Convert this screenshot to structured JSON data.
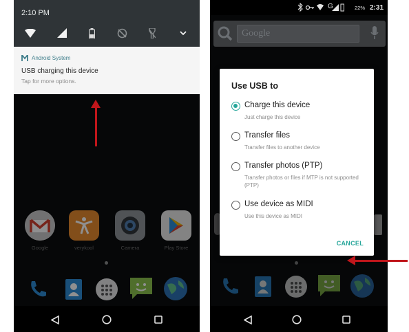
{
  "left_screen": {
    "time": "2:10 PM",
    "quick_settings": [
      "wifi-icon",
      "cellular-signal-icon",
      "battery-icon",
      "rotation-lock-icon",
      "flashlight-icon",
      "chevron-down-icon"
    ],
    "notification": {
      "app_name": "Android System",
      "title": "USB charging this device",
      "subtitle": "Tap for more options."
    },
    "apps": [
      {
        "label": "Google",
        "icon": "gmail-icon"
      },
      {
        "label": "verykool",
        "icon": "verykool-icon"
      },
      {
        "label": "Camera",
        "icon": "camera-icon"
      },
      {
        "label": "Play Store",
        "icon": "play-store-icon"
      }
    ],
    "dock": [
      "phone-icon",
      "contacts-icon",
      "app-drawer-icon",
      "messaging-icon",
      "browser-icon"
    ],
    "nav": [
      "back-icon",
      "home-icon",
      "recents-icon"
    ]
  },
  "right_screen": {
    "status_bar": {
      "time": "2:31",
      "battery": "22%",
      "network": "G"
    },
    "search_placeholder": "Google",
    "dialog": {
      "title": "Use USB to",
      "options": [
        {
          "title": "Charge this device",
          "subtitle": "Just charge this device",
          "selected": true
        },
        {
          "title": "Transfer files",
          "subtitle": "Transfer files to another device",
          "selected": false
        },
        {
          "title": "Transfer photos (PTP)",
          "subtitle": "Transfer photos or files if MTP is not supported (PTP)",
          "selected": false
        },
        {
          "title": "Use device as MIDI",
          "subtitle": "Use this device as MIDI",
          "selected": false
        }
      ],
      "cancel_label": "CANCEL"
    }
  },
  "colors": {
    "accent": "#26a69a",
    "annotation_arrow": "#c0161b",
    "shade_header": "#2f3437"
  }
}
